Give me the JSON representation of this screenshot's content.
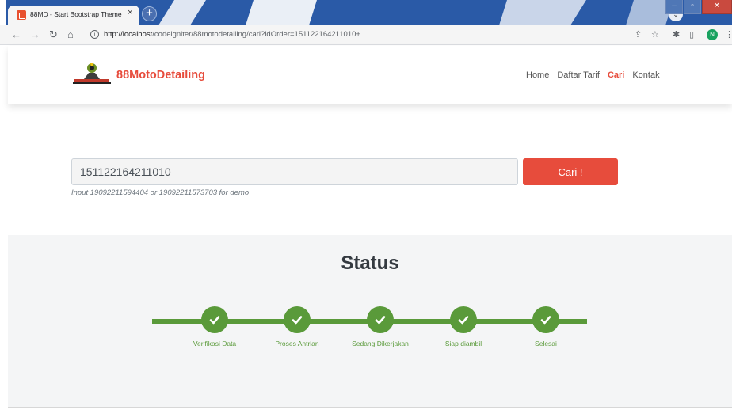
{
  "browser": {
    "tab_title": "88MD - Start Bootstrap Theme",
    "tab_close": "×",
    "new_tab": "+",
    "url_host": "http://localhost",
    "url_path": "/codeigniter/88motodetailing/cari?idOrder=151122164211010+",
    "profile_initial": "N",
    "icons": [
      "back-arrow-icon",
      "forward-arrow-icon",
      "reload-icon",
      "home-icon",
      "info-icon",
      "share-icon",
      "star-icon",
      "extensions-icon",
      "sidebar-icon",
      "menu-icon"
    ]
  },
  "navbar": {
    "brand": "88MotoDetailing",
    "links": [
      "Home",
      "Daftar Tarif",
      "Cari",
      "Kontak"
    ],
    "active_index": 2
  },
  "search": {
    "value": "151122164211010",
    "button_label": "Cari !",
    "hint": "Input 19092211594404 or 19092211573703 for demo"
  },
  "status": {
    "title": "Status",
    "steps": [
      "Verifikasi Data",
      "Proses Antrian",
      "Sedang Dikerjakan",
      "Siap diambil",
      "Selesai"
    ]
  },
  "colors": {
    "brand_red": "#e74c3c",
    "progress_green": "#5a9a3a",
    "section_bg": "#f4f5f6"
  }
}
